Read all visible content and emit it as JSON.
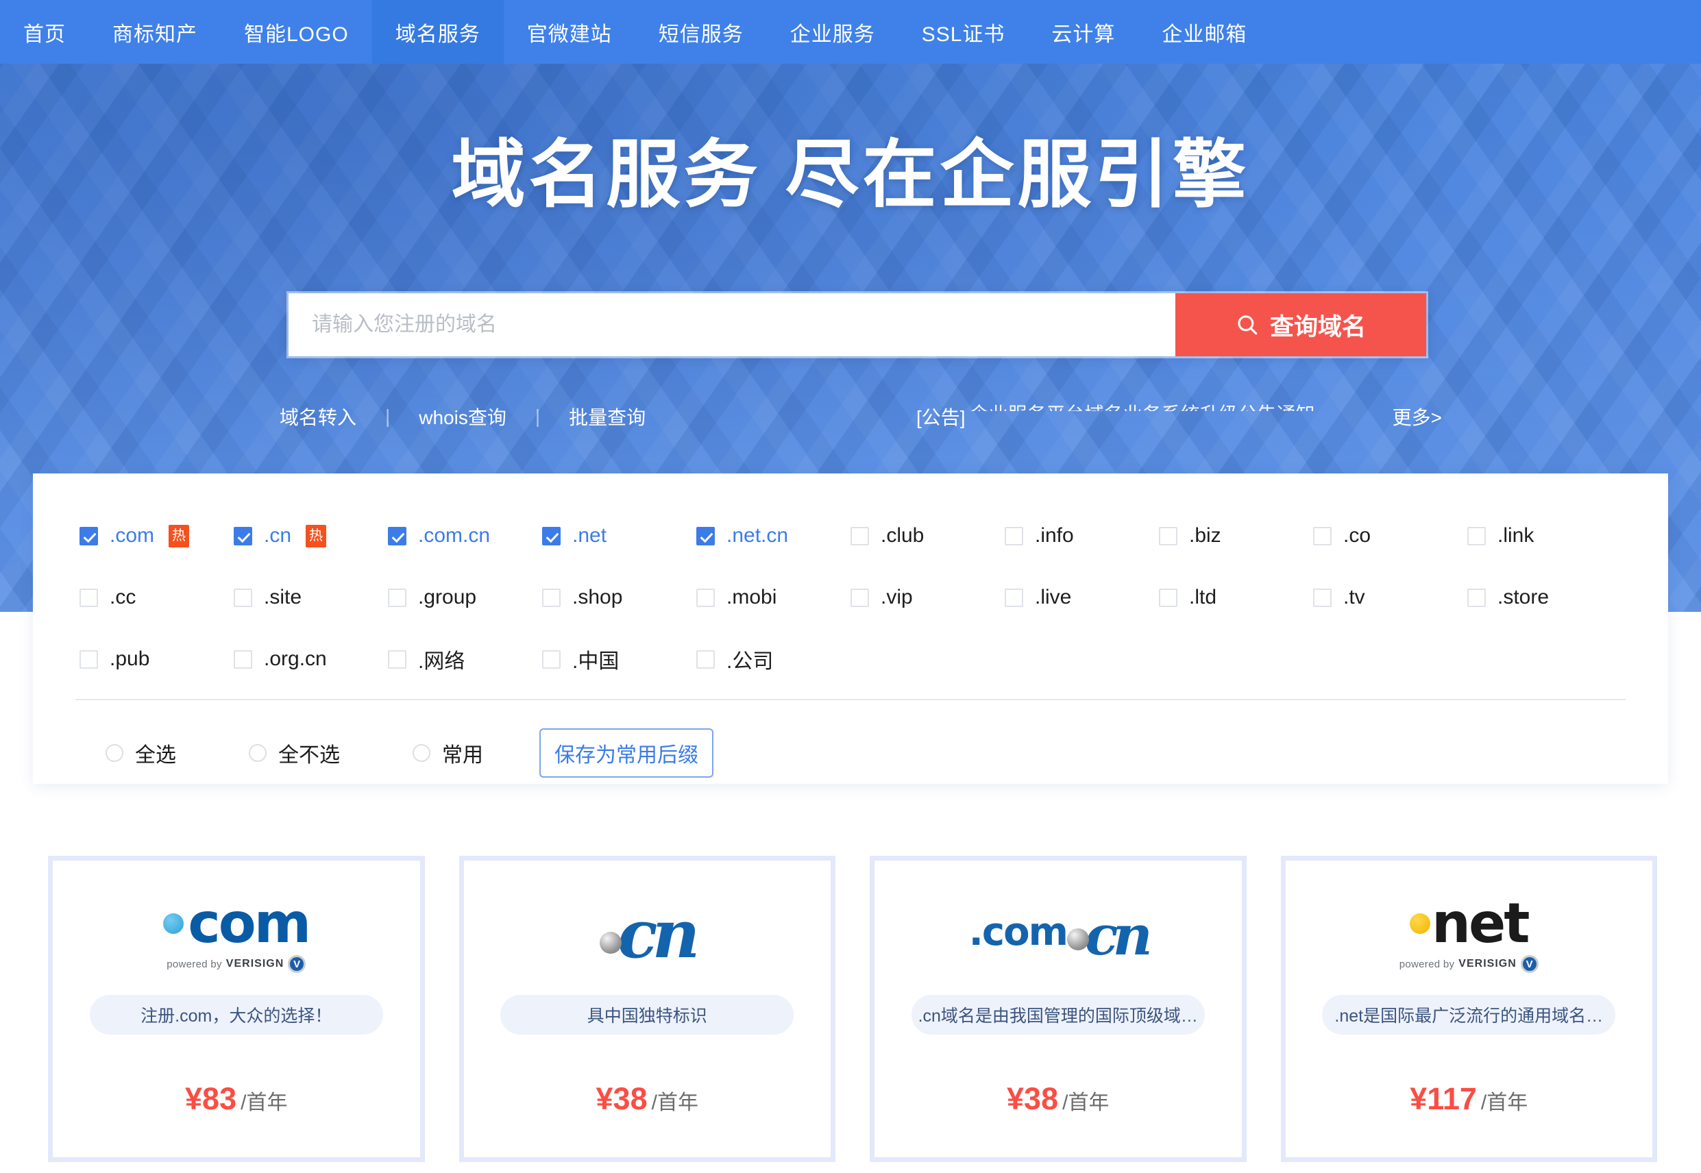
{
  "nav": {
    "items": [
      {
        "label": "首页",
        "active": false,
        "badge": null,
        "badge_color": null
      },
      {
        "label": "商标知产",
        "active": false,
        "badge": "",
        "badge_color": "#f5544c"
      },
      {
        "label": "智能LOGO",
        "active": false,
        "badge": "",
        "badge_color": "#3ed06a"
      },
      {
        "label": "域名服务",
        "active": true,
        "badge": null,
        "badge_color": null
      },
      {
        "label": "官微建站",
        "active": false,
        "badge": "",
        "badge_color": "#f5c518"
      },
      {
        "label": "短信服务",
        "active": false,
        "badge": null,
        "badge_color": null
      },
      {
        "label": "企业服务",
        "active": false,
        "badge": null,
        "badge_color": null
      },
      {
        "label": "SSL证书",
        "active": false,
        "badge": null,
        "badge_color": null
      },
      {
        "label": "云计算",
        "active": false,
        "badge": null,
        "badge_color": null
      },
      {
        "label": "企业邮箱",
        "active": false,
        "badge": null,
        "badge_color": null
      }
    ]
  },
  "hero": {
    "title": "域名服务 尽在企服引擎",
    "background_color": "#4e86e0"
  },
  "search": {
    "placeholder": "请输入您注册的域名",
    "value": "",
    "button_label": "查询域名",
    "button_color": "#f5544c",
    "search_icon": "search-icon"
  },
  "quicklinks": {
    "links": [
      "域名转入",
      "whois查询",
      "批量查询"
    ],
    "separator": "|",
    "notice_label": "[公告]",
    "notice_text": "企业服务平台域名业务系统升级公告通知",
    "more_label": "更多>"
  },
  "tld_panel": {
    "items": [
      {
        "label": ".com",
        "checked": true,
        "hot": "热"
      },
      {
        "label": ".cn",
        "checked": true,
        "hot": "热"
      },
      {
        "label": ".com.cn",
        "checked": true,
        "hot": null
      },
      {
        "label": ".net",
        "checked": true,
        "hot": null
      },
      {
        "label": ".net.cn",
        "checked": true,
        "hot": null
      },
      {
        "label": ".club",
        "checked": false,
        "hot": null
      },
      {
        "label": ".info",
        "checked": false,
        "hot": null
      },
      {
        "label": ".biz",
        "checked": false,
        "hot": null
      },
      {
        "label": ".co",
        "checked": false,
        "hot": null
      },
      {
        "label": ".link",
        "checked": false,
        "hot": null
      },
      {
        "label": ".cc",
        "checked": false,
        "hot": null
      },
      {
        "label": ".site",
        "checked": false,
        "hot": null
      },
      {
        "label": ".group",
        "checked": false,
        "hot": null
      },
      {
        "label": ".shop",
        "checked": false,
        "hot": null
      },
      {
        "label": ".mobi",
        "checked": false,
        "hot": null
      },
      {
        "label": ".vip",
        "checked": false,
        "hot": null
      },
      {
        "label": ".live",
        "checked": false,
        "hot": null
      },
      {
        "label": ".ltd",
        "checked": false,
        "hot": null
      },
      {
        "label": ".tv",
        "checked": false,
        "hot": null
      },
      {
        "label": ".store",
        "checked": false,
        "hot": null
      },
      {
        "label": ".pub",
        "checked": false,
        "hot": null
      },
      {
        "label": ".org.cn",
        "checked": false,
        "hot": null
      },
      {
        "label": ".网络",
        "checked": false,
        "hot": null
      },
      {
        "label": ".中国",
        "checked": false,
        "hot": null
      },
      {
        "label": ".公司",
        "checked": false,
        "hot": null
      }
    ],
    "controls": {
      "radios": [
        {
          "label": "全选",
          "selected": false
        },
        {
          "label": "全不选",
          "selected": false
        },
        {
          "label": "常用",
          "selected": false
        }
      ],
      "save_label": "保存为常用后缀"
    },
    "checked_color": "#3b7ce8",
    "hot_badge_color": "#f4511e"
  },
  "cards": [
    {
      "logo_type": "com",
      "logo_text": "com",
      "logo_sub_prefix": "powered by",
      "logo_sub_brand": "VERISIGN",
      "tagline": "注册.com，大众的选择！",
      "price": "¥83",
      "price_unit": "/首年"
    },
    {
      "logo_type": "cn",
      "logo_text": "cn",
      "logo_sub_prefix": null,
      "logo_sub_brand": null,
      "tagline": "具中国独特标识",
      "price": "¥38",
      "price_unit": "/首年"
    },
    {
      "logo_type": "comcn",
      "logo_text": ".com",
      "logo_sub_prefix": null,
      "logo_sub_brand": null,
      "tagline": ".cn域名是由我国管理的国际顶级域…",
      "price": "¥38",
      "price_unit": "/首年"
    },
    {
      "logo_type": "net",
      "logo_text": "net",
      "logo_sub_prefix": "powered by",
      "logo_sub_brand": "VERISIGN",
      "tagline": ".net是国际最广泛流行的通用域名…",
      "price": "¥117",
      "price_unit": "/首年"
    }
  ]
}
